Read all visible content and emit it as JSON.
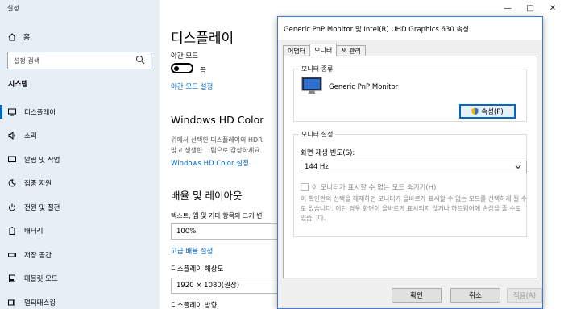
{
  "app": {
    "title": "설정"
  },
  "sidebar": {
    "home_label": "홈",
    "search_placeholder": "설정 검색",
    "section_label": "시스템",
    "items": [
      {
        "label": "디스플레이",
        "icon": "monitor-icon"
      },
      {
        "label": "소리",
        "icon": "speaker-icon"
      },
      {
        "label": "알림 및 작업",
        "icon": "notification-icon"
      },
      {
        "label": "집중 지원",
        "icon": "moon-icon"
      },
      {
        "label": "전원 및 절전",
        "icon": "power-icon"
      },
      {
        "label": "배터리",
        "icon": "battery-icon"
      },
      {
        "label": "저장 공간",
        "icon": "storage-icon"
      },
      {
        "label": "태블릿 모드",
        "icon": "tablet-icon"
      },
      {
        "label": "멀티태스킹",
        "icon": "multitask-icon"
      }
    ]
  },
  "main": {
    "page_title": "디스플레이",
    "night_mode_label": "야간 모드",
    "night_mode_state": "끔",
    "night_mode_link": "야간 모드 설정",
    "hd_title": "Windows HD Color",
    "hd_desc_line1": "위에서 선택한 디스플레이의 HDR",
    "hd_desc_line2": "밝고 생생한 그림으로 감상하세요.",
    "hd_link": "Windows HD Color 설정",
    "layout_title": "배율 및 레이아웃",
    "scale_label": "텍스트, 앱 및 기타 항목의 크기 변",
    "scale_value": "100%",
    "advanced_scale_link": "고급 배율 설정",
    "resolution_label": "디스플레이 해상도",
    "resolution_value": "1920 × 1080(권장)",
    "orientation_label": "디스플레이 방향"
  },
  "dialog": {
    "title": "Generic PnP Monitor 및 Intel(R) UHD Graphics 630 속성",
    "tabs": [
      "어댑터",
      "모니터",
      "색 관리"
    ],
    "active_tab": "모니터",
    "monitor_type_group": "모니터 종류",
    "monitor_name": "Generic PnP Monitor",
    "properties_button": "속성(P)",
    "monitor_settings_group": "모니터 설정",
    "refresh_label": "화면 재생 빈도(S):",
    "refresh_value": "144 Hz",
    "hide_modes_label": "이 모니터가 표시할 수 없는 모드 숨기기(H)",
    "warning_text": "이 확인란의 선택을 해제하면 모니터가 올바르게 표시할 수 없는 모드를 선택하게 될 수도 있습니다. 이런 경우 화면이 올바르게 표시되지 않거나 하드웨어에 손상을 줄 수도 있습니다.",
    "ok_button": "확인",
    "cancel_button": "취소",
    "apply_button": "적용(A)"
  },
  "colors": {
    "accent": "#0067c0",
    "sidebar_bg": "#e6eef6",
    "dialog_bg": "#f0f0f0"
  }
}
